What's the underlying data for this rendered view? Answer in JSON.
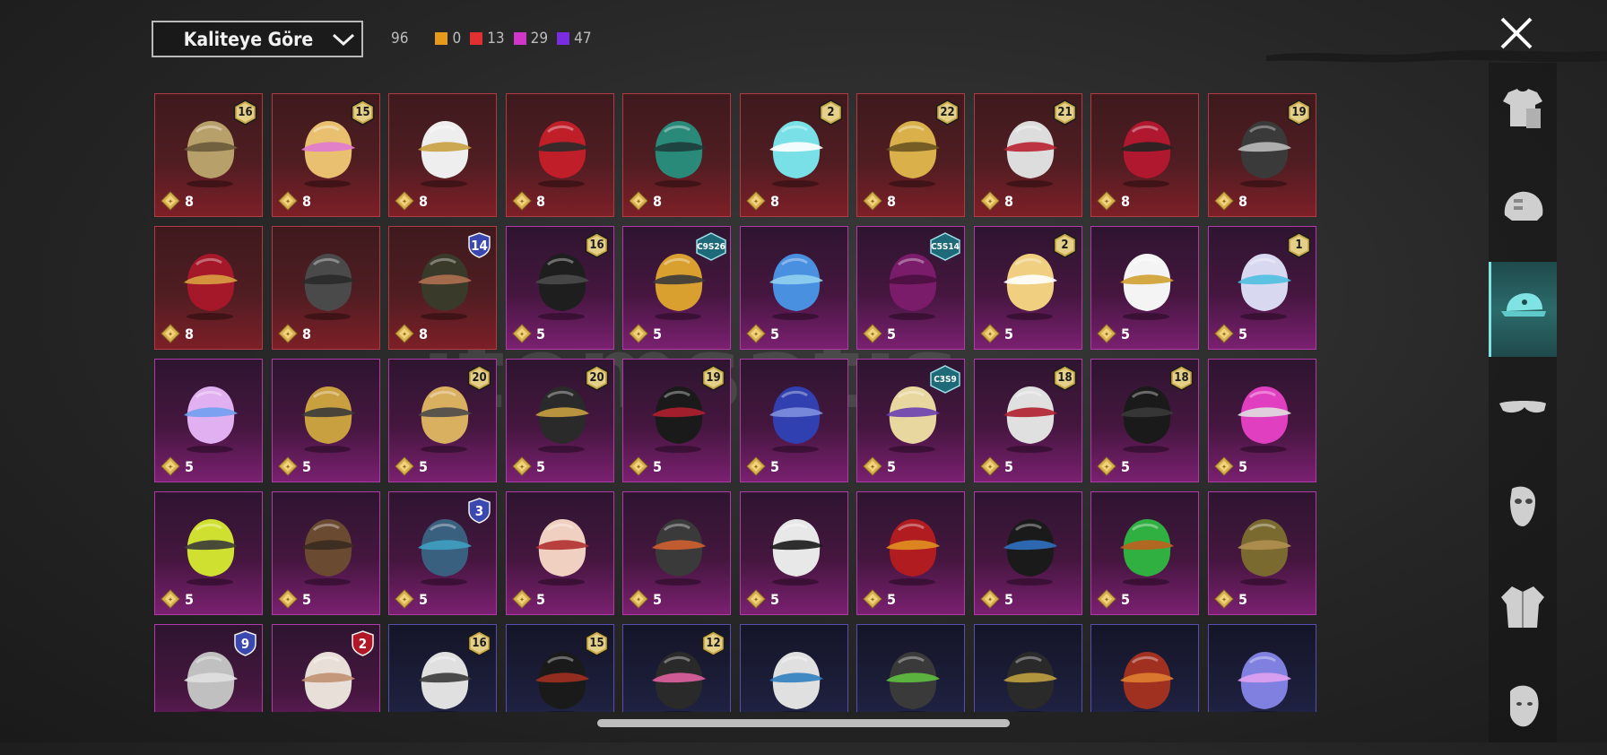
{
  "header": {
    "sort_label": "Kaliteye Göre",
    "total_count": "96",
    "quality_counts": [
      {
        "color": "#e69a1c",
        "value": "0"
      },
      {
        "color": "#e03030",
        "value": "13"
      },
      {
        "color": "#d236c8",
        "value": "29"
      },
      {
        "color": "#7a2ce0",
        "value": "47"
      }
    ]
  },
  "watermark": "itemsatis",
  "items": [
    {
      "quality": "red",
      "price": "8",
      "badge": "16",
      "badge_type": "level",
      "icon": "goggle-hat-icon"
    },
    {
      "quality": "red",
      "price": "8",
      "badge": "15",
      "badge_type": "level",
      "icon": "blonde-hair-bow-icon"
    },
    {
      "quality": "red",
      "price": "8",
      "badge": "",
      "badge_type": "",
      "icon": "white-cowboy-hat-icon"
    },
    {
      "quality": "red",
      "price": "8",
      "badge": "",
      "badge_type": "",
      "icon": "red-helmet-icon"
    },
    {
      "quality": "red",
      "price": "8",
      "badge": "",
      "badge_type": "",
      "icon": "dragon-helmet-icon"
    },
    {
      "quality": "red",
      "price": "8",
      "badge": "2",
      "badge_type": "level",
      "icon": "cyan-bucket-hat-icon"
    },
    {
      "quality": "red",
      "price": "8",
      "badge": "22",
      "badge_type": "level",
      "icon": "gold-pharaoh-helmet-icon"
    },
    {
      "quality": "red",
      "price": "8",
      "badge": "21",
      "badge_type": "level",
      "icon": "joker-mask-icon"
    },
    {
      "quality": "red",
      "price": "8",
      "badge": "",
      "badge_type": "",
      "icon": "oni-mask-icon"
    },
    {
      "quality": "red",
      "price": "8",
      "badge": "19",
      "badge_type": "level",
      "icon": "black-helmet-icon"
    },
    {
      "quality": "red",
      "price": "8",
      "badge": "",
      "badge_type": "",
      "icon": "red-visor-helmet-icon"
    },
    {
      "quality": "red",
      "price": "8",
      "badge": "",
      "badge_type": "",
      "icon": "cap-mask-icon"
    },
    {
      "quality": "red",
      "price": "8",
      "badge": "14",
      "badge_type": "shield",
      "icon": "officer-cap-icon"
    },
    {
      "quality": "purple",
      "price": "5",
      "badge": "16",
      "badge_type": "level",
      "icon": "black-hood-icon"
    },
    {
      "quality": "purple",
      "price": "5",
      "badge": "C9S26",
      "badge_type": "season",
      "icon": "bee-mascot-icon"
    },
    {
      "quality": "purple",
      "price": "5",
      "badge": "",
      "badge_type": "",
      "icon": "blue-bird-hat-icon"
    },
    {
      "quality": "purple",
      "price": "5",
      "badge": "C5S14",
      "badge_type": "season",
      "icon": "purple-hair-icon"
    },
    {
      "quality": "purple",
      "price": "5",
      "badge": "2",
      "badge_type": "level",
      "icon": "maid-headband-icon"
    },
    {
      "quality": "purple",
      "price": "5",
      "badge": "",
      "badge_type": "",
      "icon": "chicken-mask-icon"
    },
    {
      "quality": "purple",
      "price": "5",
      "badge": "1",
      "badge_type": "level",
      "icon": "twin-tail-hair-icon"
    },
    {
      "quality": "purple",
      "price": "5",
      "badge": "",
      "badge_type": "",
      "icon": "cat-headphones-icon"
    },
    {
      "quality": "purple",
      "price": "5",
      "badge": "",
      "badge_type": "",
      "icon": "anubis-helmet-icon"
    },
    {
      "quality": "purple",
      "price": "5",
      "badge": "20",
      "badge_type": "level",
      "icon": "witch-hat-icon"
    },
    {
      "quality": "purple",
      "price": "5",
      "badge": "20",
      "badge_type": "level",
      "icon": "gold-skull-mask-icon"
    },
    {
      "quality": "purple",
      "price": "5",
      "badge": "19",
      "badge_type": "level",
      "icon": "black-hair-ribbon-icon"
    },
    {
      "quality": "purple",
      "price": "5",
      "badge": "",
      "badge_type": "",
      "icon": "blue-wolf-mask-icon"
    },
    {
      "quality": "purple",
      "price": "5",
      "badge": "C3S9",
      "badge_type": "season",
      "icon": "bear-hat-icon"
    },
    {
      "quality": "purple",
      "price": "5",
      "badge": "18",
      "badge_type": "level",
      "icon": "uncle-sam-hat-icon"
    },
    {
      "quality": "purple",
      "price": "5",
      "badge": "18",
      "badge_type": "level",
      "icon": "black-bun-hair-icon"
    },
    {
      "quality": "purple",
      "price": "5",
      "badge": "",
      "badge_type": "",
      "icon": "pink-visor-helmet-icon"
    },
    {
      "quality": "purple",
      "price": "5",
      "badge": "",
      "badge_type": "",
      "icon": "yellow-bucket-hat-icon"
    },
    {
      "quality": "purple",
      "price": "5",
      "badge": "",
      "badge_type": "",
      "icon": "brown-fedora-icon"
    },
    {
      "quality": "purple",
      "price": "5",
      "badge": "3",
      "badge_type": "shield",
      "icon": "ufo-hat-icon"
    },
    {
      "quality": "purple",
      "price": "5",
      "badge": "",
      "badge_type": "",
      "icon": "cake-hat-icon"
    },
    {
      "quality": "purple",
      "price": "5",
      "badge": "",
      "badge_type": "",
      "icon": "bandana-icon"
    },
    {
      "quality": "purple",
      "price": "5",
      "badge": "",
      "badge_type": "",
      "icon": "zebra-mask-icon"
    },
    {
      "quality": "purple",
      "price": "5",
      "badge": "",
      "badge_type": "",
      "icon": "red-mech-helmet-icon"
    },
    {
      "quality": "purple",
      "price": "5",
      "badge": "",
      "badge_type": "",
      "icon": "ski-mask-goggles-icon"
    },
    {
      "quality": "purple",
      "price": "5",
      "badge": "",
      "badge_type": "",
      "icon": "frog-hat-icon"
    },
    {
      "quality": "purple",
      "price": "5",
      "badge": "",
      "badge_type": "",
      "icon": "aviator-cap-icon"
    },
    {
      "quality": "purple",
      "price": "",
      "badge": "9",
      "badge_type": "shield",
      "icon": "grey-dreadlocks-icon"
    },
    {
      "quality": "purple",
      "price": "",
      "badge": "2",
      "badge_type": "shield-red",
      "icon": "rabbit-mask-icon"
    },
    {
      "quality": "dark",
      "price": "",
      "badge": "16",
      "badge_type": "level",
      "icon": "beanie-goggles-icon"
    },
    {
      "quality": "dark",
      "price": "",
      "badge": "15",
      "badge_type": "level",
      "icon": "red-hair-hood-icon"
    },
    {
      "quality": "dark",
      "price": "",
      "badge": "12",
      "badge_type": "level",
      "icon": "bunny-ear-helmet-icon"
    },
    {
      "quality": "dark",
      "price": "",
      "badge": "",
      "badge_type": "",
      "icon": "printed-cap-icon"
    },
    {
      "quality": "dark",
      "price": "",
      "badge": "",
      "badge_type": "",
      "icon": "gas-mask-helmet-icon"
    },
    {
      "quality": "dark",
      "price": "",
      "badge": "",
      "badge_type": "",
      "icon": "black-bike-helmet-icon"
    },
    {
      "quality": "dark",
      "price": "",
      "badge": "",
      "badge_type": "",
      "icon": "red-hair-goggles-icon"
    },
    {
      "quality": "dark",
      "price": "",
      "badge": "",
      "badge_type": "",
      "icon": "galaxy-cap-icon"
    }
  ],
  "sidebar": [
    {
      "icon": "outfit-icon",
      "active": false
    },
    {
      "icon": "helmet-icon",
      "active": false
    },
    {
      "icon": "cap-icon",
      "active": true
    },
    {
      "icon": "glasses-icon",
      "active": false
    },
    {
      "icon": "face-mask-icon",
      "active": false
    },
    {
      "icon": "jacket-icon",
      "active": false
    },
    {
      "icon": "face-icon",
      "active": false
    }
  ]
}
